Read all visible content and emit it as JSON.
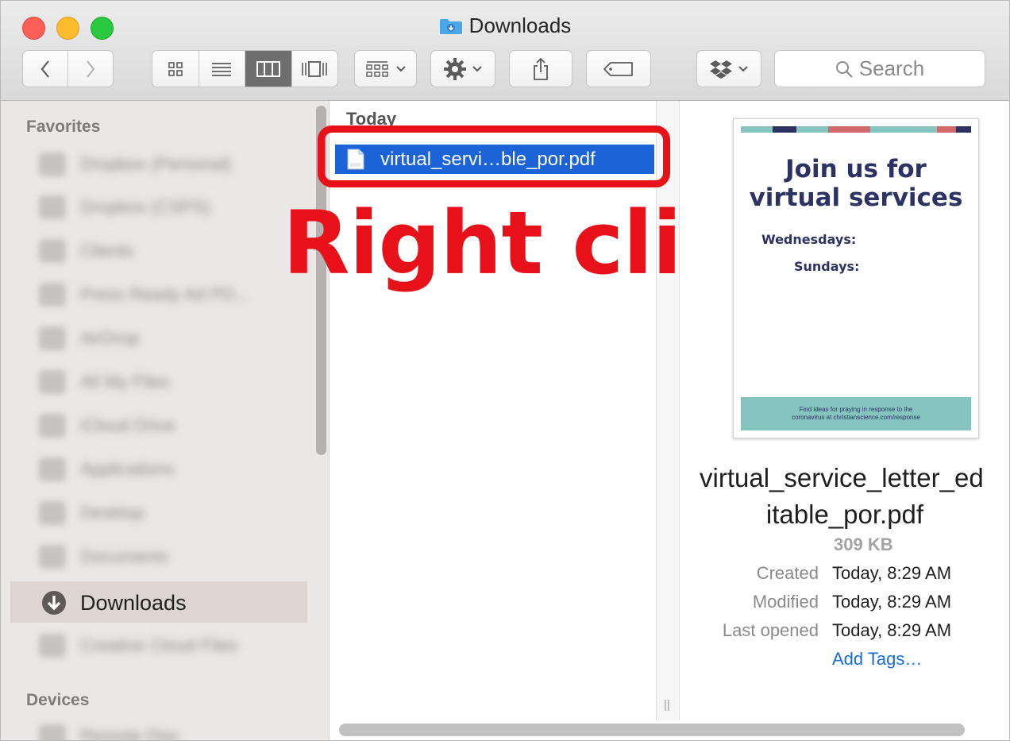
{
  "window": {
    "title": "Downloads"
  },
  "toolbar": {
    "search_label": "Search"
  },
  "sidebar": {
    "favorites_heading": "Favorites",
    "blurred_items": [
      {
        "label": "Dropbox (Personal)"
      },
      {
        "label": "Dropbox (CSPS)"
      },
      {
        "label": "Clients"
      },
      {
        "label": "Press Ready Ad PD..."
      },
      {
        "label": "AirDrop"
      },
      {
        "label": "All My Files"
      },
      {
        "label": "iCloud Drive"
      },
      {
        "label": "Applications"
      },
      {
        "label": "Desktop"
      },
      {
        "label": "Documents"
      }
    ],
    "selected_item": "Downloads",
    "after_item": "Creative Cloud Files",
    "devices_heading": "Devices",
    "device_item": "Remote Disc"
  },
  "file_column": {
    "group_label": "Today",
    "selected_file": "virtual_servi…ble_por.pdf"
  },
  "annotation": {
    "text": "Right click",
    "color": "#e8111a"
  },
  "preview": {
    "thumbnail": {
      "title_line1": "Join us for",
      "title_line2": "virtual services",
      "line_wed": "Wednesdays:",
      "line_sun": "Sundays:",
      "footer_line1": "Find ideas for praying in response to the",
      "footer_line2": "coronavirus at christianscience.com/response"
    },
    "filename_line1": "virtual_service_letter_ed",
    "filename_line2": "itable_por.pdf",
    "size": "309 KB",
    "created_label": "Created",
    "created_value": "Today, 8:29 AM",
    "modified_label": "Modified",
    "modified_value": "Today, 8:29 AM",
    "last_opened_label": "Last opened",
    "last_opened_value": "Today, 8:29 AM",
    "add_tags": "Add Tags…"
  },
  "colors": {
    "selection_blue": "#1b63d6",
    "annotation_red": "#e8111a",
    "link_blue": "#1b6cd8"
  }
}
